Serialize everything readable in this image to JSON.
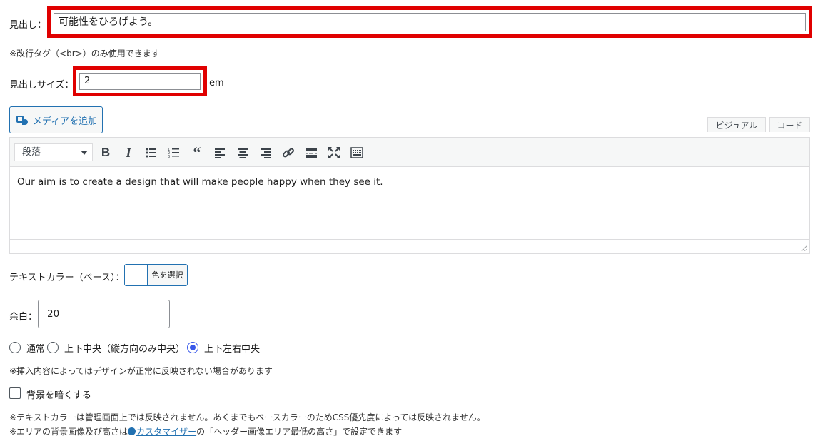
{
  "heading": {
    "label": "見出し：",
    "value": "可能性をひろげよう。",
    "note": "※改行タグ（<br>）のみ使用できます"
  },
  "heading_size": {
    "label": "見出しサイズ：",
    "value": "2",
    "unit": "em"
  },
  "editor": {
    "media_button": "メディアを追加",
    "tabs": [
      "ビジュアル",
      "コード"
    ],
    "format_select": "段落",
    "toolbar_icons": [
      "bold-icon",
      "italic-icon",
      "bullet-list-icon",
      "numbered-list-icon",
      "blockquote-icon",
      "align-left-icon",
      "align-center-icon",
      "align-right-icon",
      "link-icon",
      "read-more-icon",
      "fullscreen-icon",
      "toolbar-toggle-icon"
    ],
    "content": "Our aim is to create a design that will make people happy when they see it."
  },
  "text_color": {
    "label": "テキストカラー（ベース）：",
    "button": "色を選択"
  },
  "margin": {
    "label": "余白：",
    "value": "20"
  },
  "alignment": {
    "options": [
      "通常",
      "上下中央（縦方向のみ中央）",
      "上下左右中央"
    ],
    "selected_index": 2,
    "note": "※挿入内容によってはデザインが正常に反映されない場合があります"
  },
  "darken": {
    "label": "背景を暗くする",
    "checked": false
  },
  "footer_notes": {
    "line1": "※テキストカラーは管理画面上では反映されません。あくまでもベースカラーのためCSS優先度によっては反映されません。",
    "line2_prefix": "※エリアの背景画像及び高さは",
    "line2_link": "カスタマイザー",
    "line2_suffix": "の「ヘッダー画像エリア最低の高さ」で設定できます"
  },
  "colors": {
    "highlight_border": "#e00000",
    "accent": "#2271b1",
    "radio_checked": "#3858e9"
  }
}
